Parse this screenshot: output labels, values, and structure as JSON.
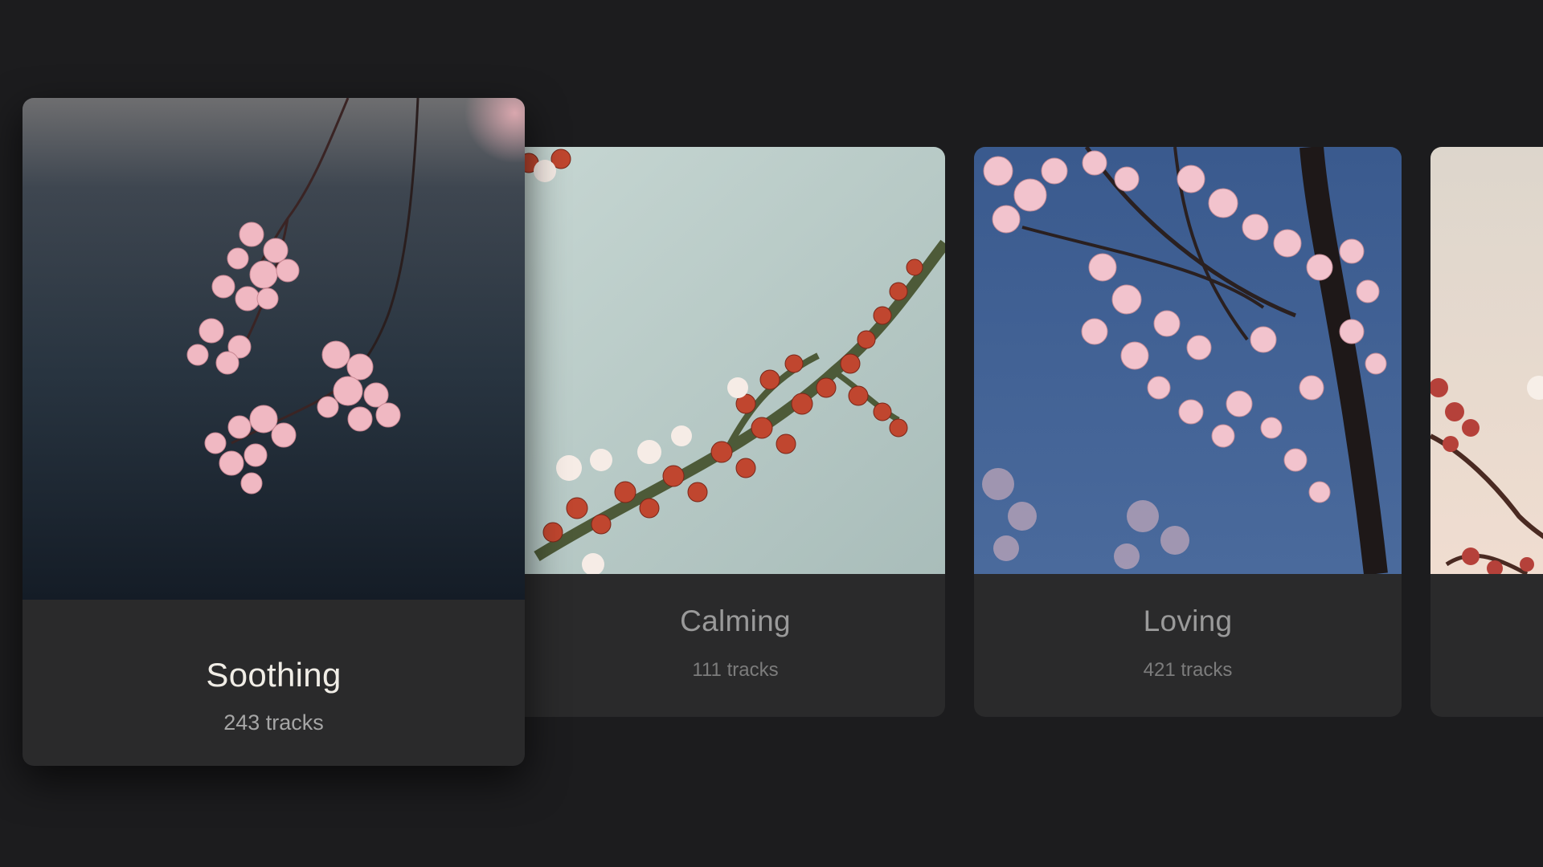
{
  "playlists": [
    {
      "title": "Soothing",
      "tracks": "243 tracks",
      "featured": true,
      "art_colors": {
        "sky": "#2b3540",
        "blossom": "#f0b8c2"
      }
    },
    {
      "title": "Calming",
      "tracks": "111 tracks",
      "featured": false,
      "art_colors": {
        "sky": "#b9ccc8",
        "blossom": "#c0462f"
      }
    },
    {
      "title": "Loving",
      "tracks": "421 tracks",
      "featured": false,
      "art_colors": {
        "sky": "#3e5f93",
        "blossom": "#f2c3cd"
      }
    },
    {
      "title": "",
      "tracks": "",
      "featured": false,
      "art_colors": {
        "sky": "#e8d6cc",
        "blossom": "#b5413a"
      }
    }
  ],
  "theme": {
    "background": "#1c1c1e",
    "card": "#2a2a2b"
  }
}
